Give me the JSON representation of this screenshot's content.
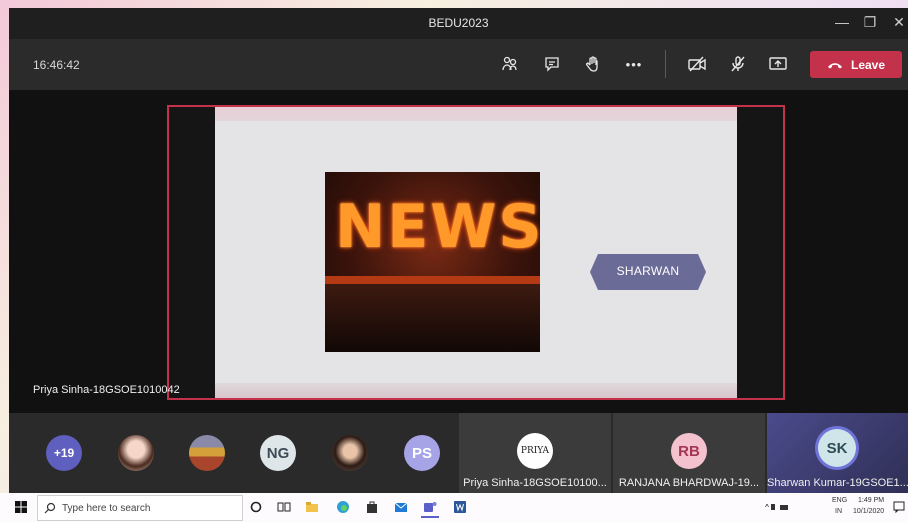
{
  "window": {
    "title": "BEDU2023",
    "minimize_glyph": "—",
    "restore_glyph": "❐",
    "close_glyph": "✕"
  },
  "meeting": {
    "clock": "16:46:42",
    "toolbar_icons": [
      "people-icon",
      "chat-icon",
      "raise-hand-icon",
      "more-icon",
      "camera-off-icon",
      "mic-off-icon",
      "share-screen-icon"
    ],
    "more_glyph": "•••",
    "leave_label": "Leave",
    "leave_color": "#c4314b"
  },
  "stage": {
    "presenter_name": "Priya Sinha-18GSOE1010042",
    "slide": {
      "image_text": "NEWS",
      "tag_label": "SHARWAN",
      "tag_color": "#6b6b97"
    }
  },
  "tray": {
    "overflow_count": "+19",
    "avatars": [
      {
        "initials": "NG",
        "color": "#dfe6ea",
        "text_color": "#3b4a55"
      },
      {
        "initials": "PS",
        "color": "#a6a3e6",
        "text_color": "#ffffff"
      }
    ],
    "tiles": [
      {
        "avatar_text": "PRIYA",
        "avatar_color": "#ffffff",
        "label": "Priya Sinha-18GSOE10100..."
      },
      {
        "avatar_text": "RB",
        "avatar_color": "#f4c2cf",
        "label": "RANJANA BHARDWAJ-19..."
      },
      {
        "avatar_text": "SK",
        "avatar_color": "#cfe5ea",
        "label": "Sharwan Kumar-19GSOE1..."
      }
    ]
  },
  "taskbar": {
    "search_placeholder": "Type here to search",
    "lang_top": "ENG",
    "lang_bottom": "IN",
    "time": "1:49 PM",
    "date": "10/1/2020"
  }
}
